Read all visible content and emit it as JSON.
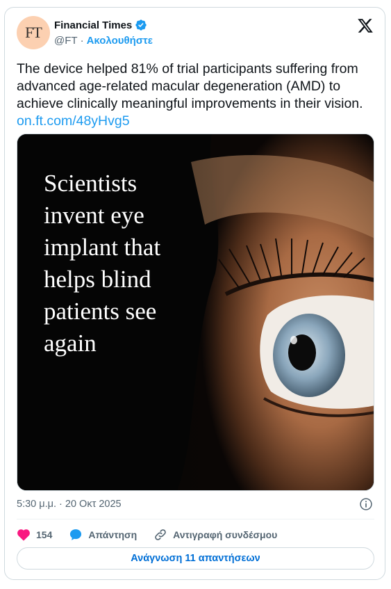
{
  "account": {
    "avatar_text": "FT",
    "name": "Financial Times",
    "handle": "@FT",
    "separator": "·",
    "follow_label": "Ακολουθήστε"
  },
  "tweet": {
    "text": "The device helped 81% of trial participants suffering from advanced age-related macular degeneration (AMD) to achieve clinically meaningful improvements in their vision.",
    "link": "on.ft.com/48yHvg5"
  },
  "media": {
    "headline": "Scientists invent eye implant that helps blind patients see again"
  },
  "meta": {
    "timestamp": "5:30 μ.μ. · 20 Οκτ 2025"
  },
  "actions": {
    "likes": "154",
    "reply_label": "Απάντηση",
    "copy_link_label": "Αντιγραφή συνδέσμου"
  },
  "read_replies_label": "Ανάγνωση 11 απαντήσεων",
  "colors": {
    "accent": "#1d9bf0",
    "like": "#f91880",
    "avatar_bg": "#fcd0b1"
  }
}
